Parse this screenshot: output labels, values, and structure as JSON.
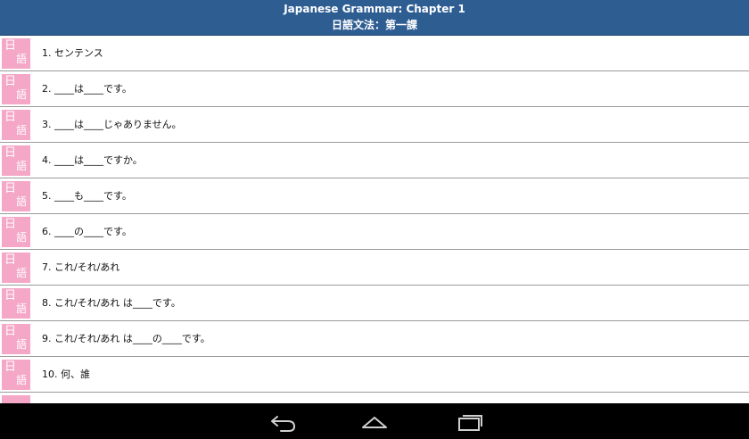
{
  "header": {
    "title_en": "Japanese Grammar: Chapter 1",
    "title_jp": "日語文法：第一課"
  },
  "list": {
    "icon_chars": [
      "日",
      "語"
    ],
    "items": [
      {
        "label": "1. センテンス"
      },
      {
        "label": "2. ____は____です。"
      },
      {
        "label": "3. ____は____じゃありません。"
      },
      {
        "label": "4. ____は____ですか。"
      },
      {
        "label": "5. ____も____です。"
      },
      {
        "label": "6. ____の____です。"
      },
      {
        "label": "7. これ/それ/あれ"
      },
      {
        "label": "8. これ/それ/あれ は____です。"
      },
      {
        "label": "9. これ/それ/あれ は____の____です。"
      },
      {
        "label": "10. 何、誰"
      }
    ]
  },
  "navbar": {
    "icons": [
      "back-icon",
      "home-icon",
      "recent-apps-icon"
    ]
  },
  "colors": {
    "header_bg": "#2e5d92",
    "icon_bg": "#f4a7c6",
    "navbar_bg": "#000000"
  }
}
